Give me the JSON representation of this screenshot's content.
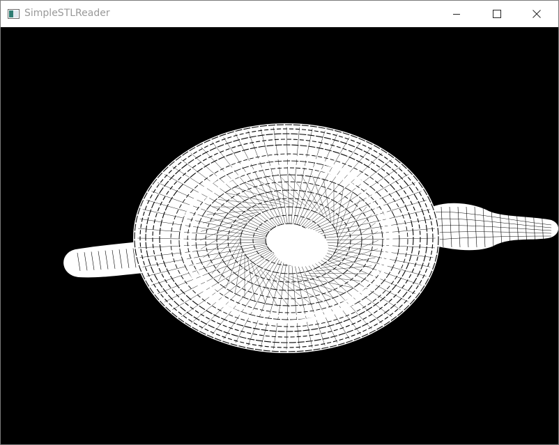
{
  "window": {
    "title": "SimpleSTLReader",
    "icon": "app-window-icon",
    "controls": {
      "minimize_icon": "minimize-icon",
      "maximize_icon": "maximize-icon",
      "close_icon": "close-icon"
    }
  },
  "viewport": {
    "background": "#000000",
    "wire_color": "#ffffff",
    "model": "teapot-wireframe-mesh"
  }
}
